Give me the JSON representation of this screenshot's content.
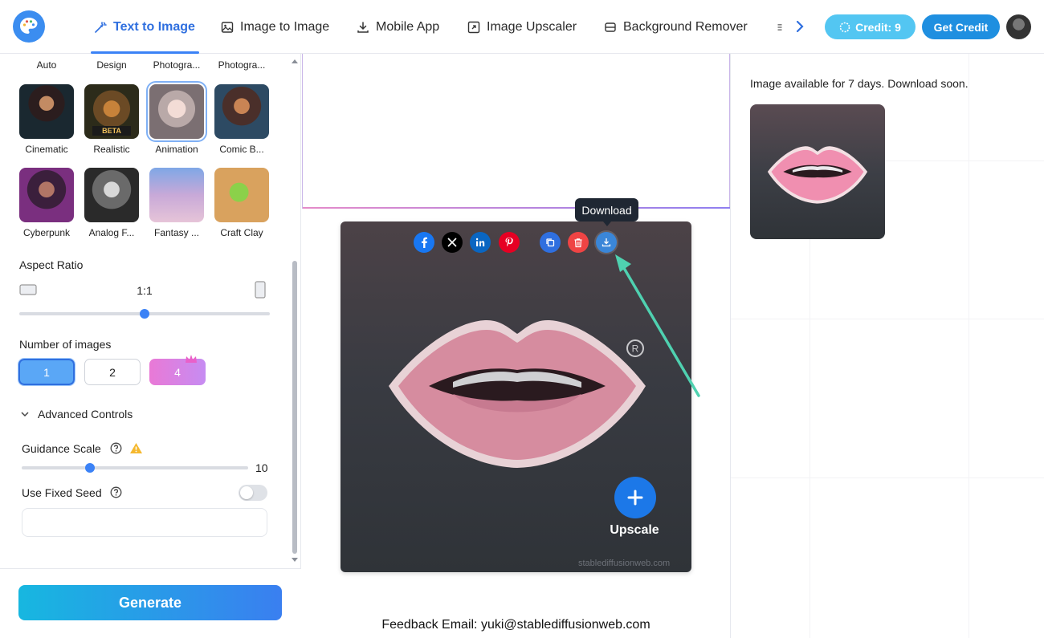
{
  "nav": {
    "items": [
      {
        "label": "Text to Image",
        "icon": "magic-wand-icon"
      },
      {
        "label": "Image to Image",
        "icon": "image-icon"
      },
      {
        "label": "Mobile App",
        "icon": "download-icon"
      },
      {
        "label": "Image Upscaler",
        "icon": "expand-icon"
      },
      {
        "label": "Background Remover",
        "icon": "eraser-icon"
      }
    ],
    "credit_label": "Credit: 9",
    "get_credit_label": "Get Credit"
  },
  "styles": {
    "top_row": [
      "Auto",
      "Design",
      "Photogra...",
      "Photogra..."
    ],
    "row1": [
      "Cinematic",
      "Realistic",
      "Animation",
      "Comic B..."
    ],
    "row2": [
      "Cyberpunk",
      "Analog F...",
      "Fantasy ...",
      "Craft Clay"
    ],
    "badge": "BETA",
    "selected": "Animation"
  },
  "aspect_ratio": {
    "title": "Aspect Ratio",
    "value": "1:1",
    "slider_position": 0.5
  },
  "num_images": {
    "title": "Number of images",
    "options": [
      "1",
      "2",
      "4"
    ],
    "selected": "1"
  },
  "advanced": {
    "title": "Advanced Controls",
    "guidance_label": "Guidance Scale",
    "guidance_value": "10",
    "guidance_position": 0.3,
    "seed_label": "Use Fixed Seed",
    "seed_enabled": false,
    "seed_value": ""
  },
  "generate_label": "Generate",
  "result": {
    "tooltip": "Download",
    "upscale_label": "Upscale",
    "watermark": "stablediffusionweb.com",
    "share_icons": [
      "facebook-icon",
      "x-icon",
      "linkedin-icon",
      "pinterest-icon",
      "copy-icon",
      "delete-icon",
      "download-icon"
    ]
  },
  "feedback": "Feedback Email: yuki@stablediffusionweb.com",
  "history": {
    "notice": "Image available for 7 days. Download soon."
  },
  "colors": {
    "accent": "#3b82f6",
    "annotation_arrow": "#4fd1b0",
    "facebook": "#1877f2",
    "x": "#000000",
    "linkedin": "#0a66c2",
    "pinterest": "#e60023",
    "copy": "#2f6fdf",
    "delete": "#ef4444",
    "download": "#3a86d8"
  }
}
